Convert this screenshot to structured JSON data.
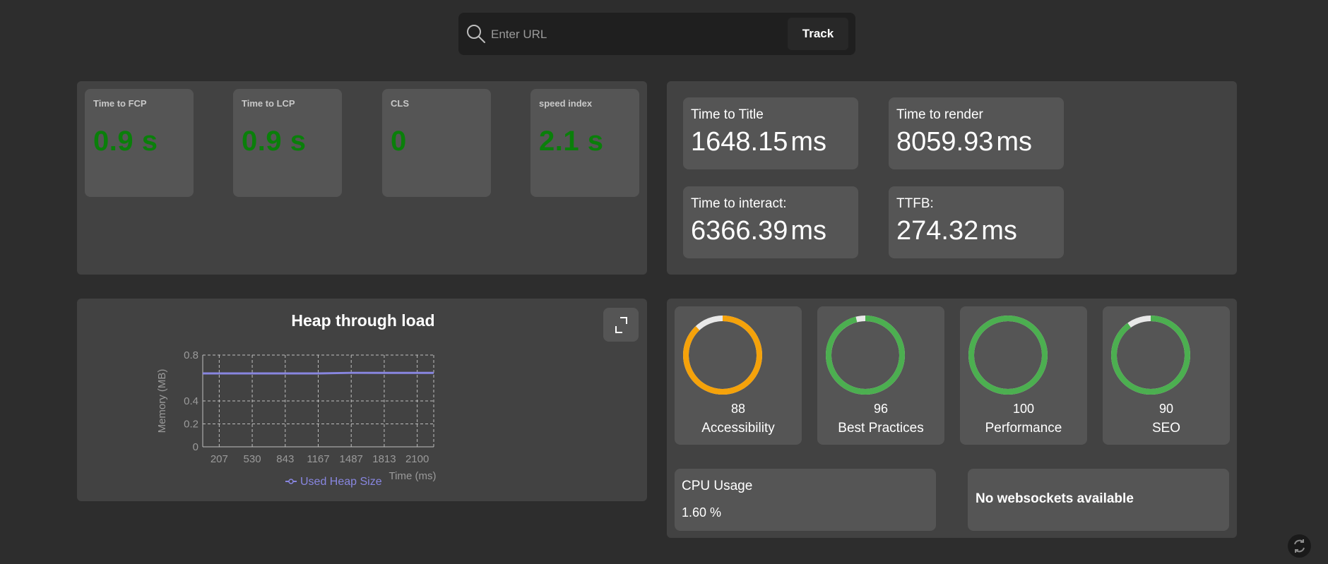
{
  "search": {
    "placeholder": "Enter URL",
    "value": "",
    "button_label": "Track",
    "icon": "search-icon"
  },
  "vitals": [
    {
      "label": "Time to FCP",
      "value": "0.9 s"
    },
    {
      "label": "Time to LCP",
      "value": "0.9 s"
    },
    {
      "label": "CLS",
      "value": "0"
    },
    {
      "label": "speed index",
      "value": "2.1 s"
    }
  ],
  "timings": [
    {
      "label": "Time to Title",
      "value": "1648.15",
      "unit": "ms"
    },
    {
      "label": "Time to render",
      "value": "8059.93",
      "unit": "ms"
    },
    {
      "label": "Time to interact:",
      "value": "6366.39",
      "unit": "ms"
    },
    {
      "label": "TTFB:",
      "value": "274.32",
      "unit": "ms"
    }
  ],
  "chart": {
    "title": "Heap through load",
    "expand_icon": "expand-icon"
  },
  "chart_data": {
    "type": "line",
    "title": "Heap through load",
    "xlabel": "Time (ms)",
    "ylabel": "Memory (MB)",
    "x": [
      207,
      530,
      843,
      1167,
      1487,
      1813,
      2100
    ],
    "x_tick_labels": [
      "207",
      "530",
      "843",
      "1167",
      "1487",
      "1813",
      "2100"
    ],
    "y_tick_labels": [
      "0",
      "0.2",
      "0.4",
      "0.8"
    ],
    "y_ticks": [
      0,
      0.2,
      0.4,
      0.8
    ],
    "ylim": [
      0,
      0.8
    ],
    "series": [
      {
        "name": "Used Heap Size",
        "values": [
          0.64,
          0.64,
          0.64,
          0.64,
          0.645,
          0.645,
          0.645
        ],
        "color": "#8886e0"
      }
    ],
    "grid": true,
    "legend": "bottom"
  },
  "scores": [
    {
      "value": 88,
      "label": "Accessibility",
      "color": "#f5a20a"
    },
    {
      "value": 96,
      "label": "Best Practices",
      "color": "#4caf50"
    },
    {
      "value": 100,
      "label": "Performance",
      "color": "#4caf50"
    },
    {
      "value": 90,
      "label": "SEO",
      "color": "#4caf50"
    }
  ],
  "cpu": {
    "label": "CPU Usage",
    "value": "1.60 %"
  },
  "websockets": {
    "message": "No websockets available"
  },
  "colors": {
    "good": "#0a7f0a",
    "ring_track": "#e8e8e8",
    "background": "#2d2d2d"
  }
}
